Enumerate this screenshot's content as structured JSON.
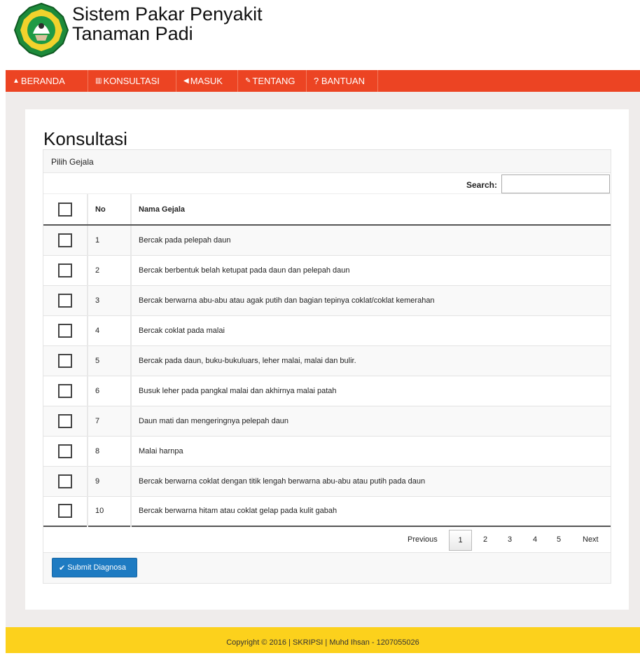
{
  "header": {
    "title_line1": "Sistem Pakar Penyakit",
    "title_line2": "Tanaman Padi"
  },
  "nav": [
    {
      "label": "BERANDA",
      "icon": "home-icon"
    },
    {
      "label": "KONSULTASI",
      "icon": "chart-icon"
    },
    {
      "label": "MASUK",
      "icon": "volume-icon"
    },
    {
      "label": "TENTANG",
      "icon": "pencil-icon"
    },
    {
      "label": "? BANTUAN",
      "icon": ""
    }
  ],
  "page": {
    "title": "Konsultasi",
    "panel_title": "Pilih Gejala",
    "search_label": "Search:",
    "search_value": ""
  },
  "table": {
    "columns": [
      "",
      "No",
      "Nama Gejala"
    ],
    "rows": [
      {
        "no": "1",
        "name": "Bercak pada pelepah daun"
      },
      {
        "no": "2",
        "name": "Bercak berbentuk belah ketupat pada daun dan pelepah daun"
      },
      {
        "no": "3",
        "name": "Bercak berwarna abu-abu atau agak putih dan bagian tepinya coklat/coklat kemerahan"
      },
      {
        "no": "4",
        "name": "Bercak coklat pada malai"
      },
      {
        "no": "5",
        "name": "Bercak pada daun, buku-bukuluars, leher malai, malai dan bulir."
      },
      {
        "no": "6",
        "name": "Busuk leher pada pangkal malai dan akhirnya malai patah"
      },
      {
        "no": "7",
        "name": "Daun mati dan mengeringnya pelepah daun"
      },
      {
        "no": "8",
        "name": "Malai harnpa"
      },
      {
        "no": "9",
        "name": "Bercak berwarna coklat dengan titik lengah berwarna abu-abu atau putih pada daun"
      },
      {
        "no": "10",
        "name": "Bercak berwarna hitam atau coklat gelap pada kulit gabah"
      }
    ]
  },
  "pager": {
    "previous": "Previous",
    "pages": [
      "1",
      "2",
      "3",
      "4",
      "5"
    ],
    "current": "1",
    "next": "Next"
  },
  "submit_label": "Submit Diagnosa",
  "footer": "Copyright © 2016 | SKRIPSI | Muhd Ihsan - 1207055026",
  "colors": {
    "navbar": "#ec4423",
    "footer": "#fcd11c",
    "button": "#1e7bc2"
  }
}
